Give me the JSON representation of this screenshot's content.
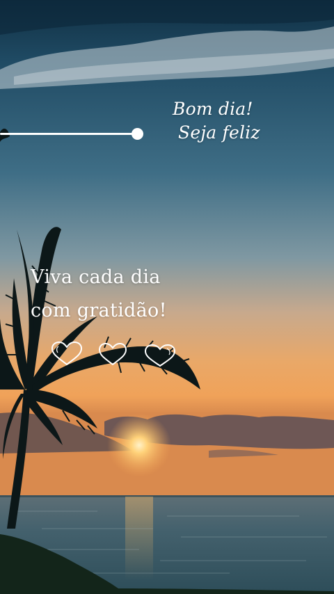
{
  "greeting": {
    "line1": "Bom dia!",
    "line2": "Seja feliz"
  },
  "quote": {
    "line1": "Viva cada dia",
    "line2": "com gratidão!"
  },
  "hearts": [
    {
      "icon": "heart-outline-icon"
    },
    {
      "icon": "heart-outline-icon"
    },
    {
      "icon": "heart-outline-icon"
    }
  ],
  "colors": {
    "text": "#ffffff",
    "sky_top": "#17394f",
    "sky_mid": "#3f6e86",
    "horizon_glow": "#f3b15d",
    "sea": "#3b5663",
    "palm": "#0d1a1c"
  }
}
